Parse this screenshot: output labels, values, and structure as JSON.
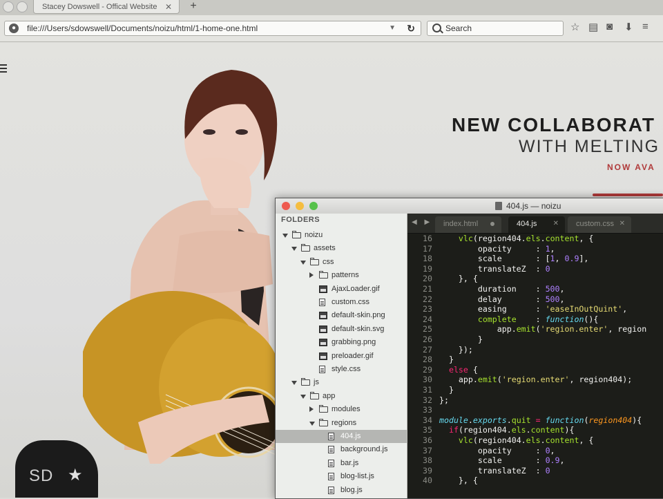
{
  "browser": {
    "tab_title": "Stacey Dowswell - Offical Website",
    "tab_close": "✕",
    "new_tab": "+",
    "url": "file:///Users/sdowswell/Documents/noizu/html/1-home-one.html",
    "search_placeholder": "Search"
  },
  "hero": {
    "line1": "NEW COLLABORAT",
    "line2": "WITH MELTING",
    "line3": "NOW AVA",
    "badge_text": "SD",
    "badge_star": "★"
  },
  "editor": {
    "title": "404.js — noizu",
    "folders_label": "FOLDERS",
    "tree": [
      {
        "label": "noizu",
        "type": "folder",
        "open": true,
        "indent": 0
      },
      {
        "label": "assets",
        "type": "folder",
        "open": true,
        "indent": 1
      },
      {
        "label": "css",
        "type": "folder",
        "open": true,
        "indent": 2
      },
      {
        "label": "patterns",
        "type": "folder",
        "open": false,
        "indent": 3
      },
      {
        "label": "AjaxLoader.gif",
        "type": "image",
        "indent": 3
      },
      {
        "label": "custom.css",
        "type": "file",
        "indent": 3
      },
      {
        "label": "default-skin.png",
        "type": "image",
        "indent": 3
      },
      {
        "label": "default-skin.svg",
        "type": "image",
        "indent": 3
      },
      {
        "label": "grabbing.png",
        "type": "image",
        "indent": 3
      },
      {
        "label": "preloader.gif",
        "type": "image",
        "indent": 3
      },
      {
        "label": "style.css",
        "type": "file",
        "indent": 3
      },
      {
        "label": "js",
        "type": "folder",
        "open": true,
        "indent": 1
      },
      {
        "label": "app",
        "type": "folder",
        "open": true,
        "indent": 2
      },
      {
        "label": "modules",
        "type": "folder",
        "open": false,
        "indent": 3
      },
      {
        "label": "regions",
        "type": "folder",
        "open": true,
        "indent": 3
      },
      {
        "label": "404.js",
        "type": "file",
        "indent": 4,
        "selected": true
      },
      {
        "label": "background.js",
        "type": "file",
        "indent": 4
      },
      {
        "label": "bar.js",
        "type": "file",
        "indent": 4
      },
      {
        "label": "blog-list.js",
        "type": "file",
        "indent": 4
      },
      {
        "label": "blog.js",
        "type": "file",
        "indent": 4
      }
    ],
    "tab_nav": "◀ ▶",
    "tabs": [
      {
        "label": "index.html",
        "active": false,
        "marker": "dot"
      },
      {
        "label": "404.js",
        "active": true,
        "marker": "x"
      },
      {
        "label": "custom.css",
        "active": false,
        "marker": "x"
      }
    ],
    "code_lines": [
      {
        "n": "16",
        "code": "    <span class='grn'>vlc</span>(region404.<span class='grn'>els</span>.<span class='grn'>content</span>, {"
      },
      {
        "n": "17",
        "code": "        opacity     : <span class='num'>1</span>,"
      },
      {
        "n": "18",
        "code": "        scale       : [<span class='num'>1</span>, <span class='num'>0.9</span>],"
      },
      {
        "n": "19",
        "code": "        translateZ  : <span class='num'>0</span>"
      },
      {
        "n": "20",
        "code": "    }, {"
      },
      {
        "n": "21",
        "code": "        duration    : <span class='num'>500</span>,"
      },
      {
        "n": "22",
        "code": "        delay       : <span class='num'>500</span>,"
      },
      {
        "n": "23",
        "code": "        easing      : <span class='str'>'easeInOutQuint'</span>,"
      },
      {
        "n": "24",
        "code": "        <span class='grn'>complete</span>    : <span class='fn'>function</span>(){"
      },
      {
        "n": "25",
        "code": "            app.<span class='grn'>emit</span>(<span class='str'>'region.enter'</span>, region"
      },
      {
        "n": "26",
        "code": "        }"
      },
      {
        "n": "27",
        "code": "    });"
      },
      {
        "n": "28",
        "code": "  }"
      },
      {
        "n": "29",
        "code": "  <span class='kw'>else</span> {"
      },
      {
        "n": "30",
        "code": "    app.<span class='grn'>emit</span>(<span class='str'>'region.enter'</span>, region404);"
      },
      {
        "n": "31",
        "code": "  }"
      },
      {
        "n": "32",
        "code": "};"
      },
      {
        "n": "33",
        "code": ""
      },
      {
        "n": "34",
        "code": "<span class='fn'>module</span>.<span class='fn'>exports</span>.<span class='grn'>quit</span> <span class='kw'>=</span> <span class='fn'>function</span>(<span class='prm'>region404</span>){"
      },
      {
        "n": "35",
        "code": "  <span class='kw'>if</span>(region404.<span class='grn'>els</span>.<span class='grn'>content</span>){"
      },
      {
        "n": "36",
        "code": "    <span class='grn'>vlc</span>(region404.<span class='grn'>els</span>.<span class='grn'>content</span>, {"
      },
      {
        "n": "37",
        "code": "        opacity     : <span class='num'>0</span>,"
      },
      {
        "n": "38",
        "code": "        scale       : <span class='num'>0.9</span>,"
      },
      {
        "n": "39",
        "code": "        translateZ  : <span class='num'>0</span>"
      },
      {
        "n": "40",
        "code": "    }, {"
      }
    ]
  },
  "colors": {
    "accent_red": "#b03a3a",
    "editor_bg": "#1c1d19",
    "sidebar_bg": "#eceeeb"
  }
}
